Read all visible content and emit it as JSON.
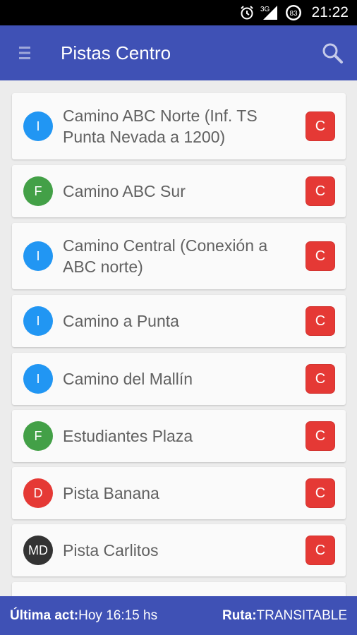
{
  "status_bar": {
    "time": "21:22",
    "battery": "83",
    "network": "3G",
    "icons": [
      "alarm-icon",
      "signal-icon",
      "battery-icon"
    ]
  },
  "app_bar": {
    "title": "Pistas Centro",
    "menu_icon": "menu-icon",
    "search_icon": "search-icon"
  },
  "trails": [
    {
      "badge": "I",
      "badge_color": "#2196f3",
      "name": "Camino ABC Norte (Inf. TS Punta Nevada a 1200)",
      "status": "C"
    },
    {
      "badge": "F",
      "badge_color": "#43a047",
      "name": "Camino ABC Sur",
      "status": "C"
    },
    {
      "badge": "I",
      "badge_color": "#2196f3",
      "name": "Camino Central (Conexión a ABC norte)",
      "status": "C"
    },
    {
      "badge": "I",
      "badge_color": "#2196f3",
      "name": "Camino a Punta",
      "status": "C"
    },
    {
      "badge": "I",
      "badge_color": "#2196f3",
      "name": "Camino del Mallín",
      "status": "C"
    },
    {
      "badge": "F",
      "badge_color": "#43a047",
      "name": "Estudiantes Plaza",
      "status": "C"
    },
    {
      "badge": "D",
      "badge_color": "#e53935",
      "name": "Pista Banana",
      "status": "C"
    },
    {
      "badge": "MD",
      "badge_color": "#333333",
      "name": "Pista Carlitos",
      "status": "C"
    }
  ],
  "colors": {
    "primary": "#3f51b5",
    "closed": "#e53935"
  },
  "footer": {
    "update_label": "Última act:",
    "update_value": "Hoy 16:15 hs",
    "route_label": "Ruta:",
    "route_value": "TRANSITABLE"
  }
}
